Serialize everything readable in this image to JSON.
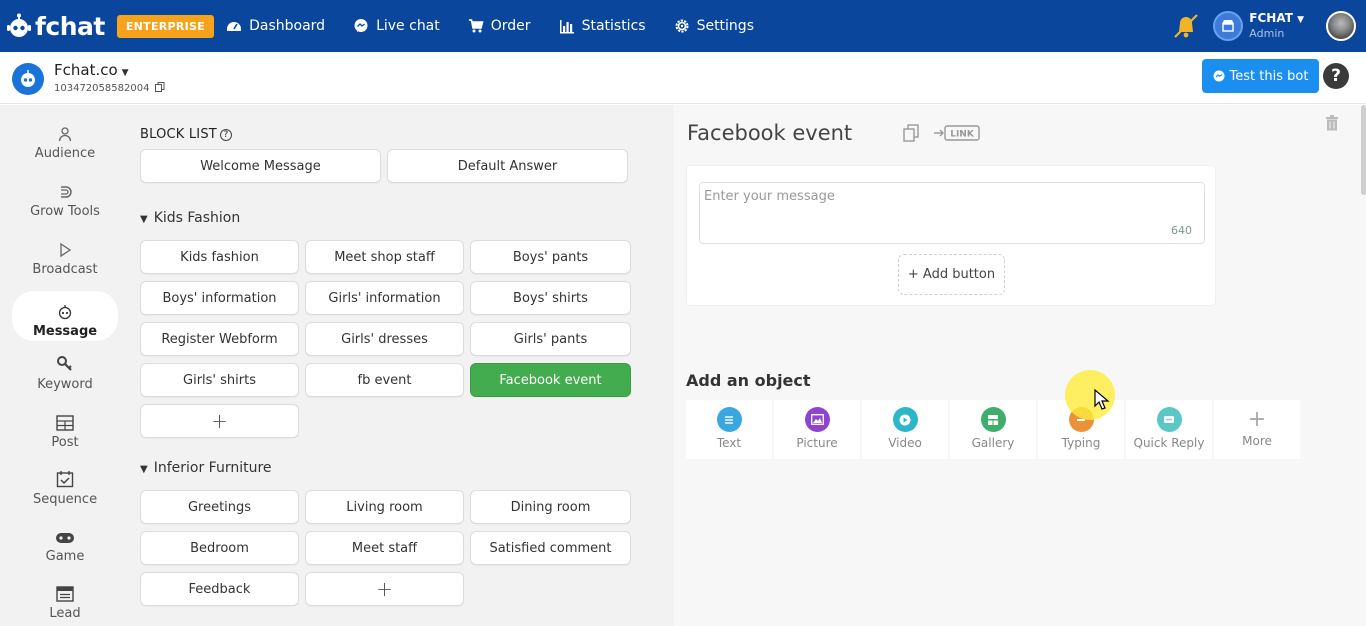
{
  "topbar": {
    "brand": "fchat",
    "plan_badge": "ENTERPRISE",
    "nav": [
      {
        "label": "Dashboard",
        "icon": "dashboard-icon"
      },
      {
        "label": "Live chat",
        "icon": "chat-bubble-icon"
      },
      {
        "label": "Order",
        "icon": "cart-icon"
      },
      {
        "label": "Statistics",
        "icon": "bar-chart-icon"
      },
      {
        "label": "Settings",
        "icon": "gear-icon"
      }
    ],
    "user_name": "FCHAT",
    "user_role": "Admin"
  },
  "page": {
    "name": "Fchat.co",
    "id": "103472058582004"
  },
  "test_bot_label": "Test this bot",
  "sidebar": {
    "items": [
      {
        "label": "Audience",
        "icon": "user-icon"
      },
      {
        "label": "Grow Tools",
        "icon": "magnet-icon"
      },
      {
        "label": "Broadcast",
        "icon": "play-icon"
      },
      {
        "label": "Message",
        "icon": "robot-icon",
        "active": true
      },
      {
        "label": "Keyword",
        "icon": "key-icon"
      },
      {
        "label": "Post",
        "icon": "table-icon"
      },
      {
        "label": "Sequence",
        "icon": "calendar-check-icon"
      },
      {
        "label": "Game",
        "icon": "gamepad-icon"
      },
      {
        "label": "Lead",
        "icon": "list-icon"
      }
    ]
  },
  "block_list": {
    "title": "BLOCK LIST",
    "top_blocks": [
      "Welcome Message",
      "Default Answer"
    ],
    "groups": [
      {
        "name": "Kids Fashion",
        "blocks": [
          "Kids fashion",
          "Meet shop staff",
          "Boys' pants",
          "Boys' information",
          "Girls' information",
          "Boys' shirts",
          "Register Webform",
          "Girls' dresses",
          "Girls' pants",
          "Girls' shirts",
          "fb event",
          "Facebook event"
        ],
        "selected": "Facebook event",
        "add_label": "+"
      },
      {
        "name": "Inferior Furniture",
        "blocks": [
          "Greetings",
          "Living room",
          "Dining room",
          "Bedroom",
          "Meet staff",
          "Satisfied comment",
          "Feedback"
        ],
        "add_label": "+"
      }
    ]
  },
  "editor": {
    "title": "Facebook event",
    "link_label": "LINK",
    "message_placeholder": "Enter your message",
    "char_count": "640",
    "add_button_label": "+ Add button",
    "add_object_title": "Add an object",
    "objects": [
      {
        "label": "Text",
        "icon": "text-lines-icon",
        "color": "#3aa7e0"
      },
      {
        "label": "Picture",
        "icon": "picture-icon",
        "color": "#8e44ce"
      },
      {
        "label": "Video",
        "icon": "play-circle-icon",
        "color": "#2bb6c9"
      },
      {
        "label": "Gallery",
        "icon": "gallery-grid-icon",
        "color": "#3fae6a"
      },
      {
        "label": "Typing",
        "icon": "typing-dots-icon",
        "color": "#e9923a"
      },
      {
        "label": "Quick Reply",
        "icon": "quick-reply-icon",
        "color": "#5cc7c7"
      },
      {
        "label": "More",
        "icon": "plus-icon",
        "color": "#aaaaaa"
      }
    ]
  },
  "colors": {
    "topbar": "#0a469c",
    "badge": "#f7a21b",
    "selected_block": "#43ac4f",
    "primary_button": "#1b8ff0"
  }
}
